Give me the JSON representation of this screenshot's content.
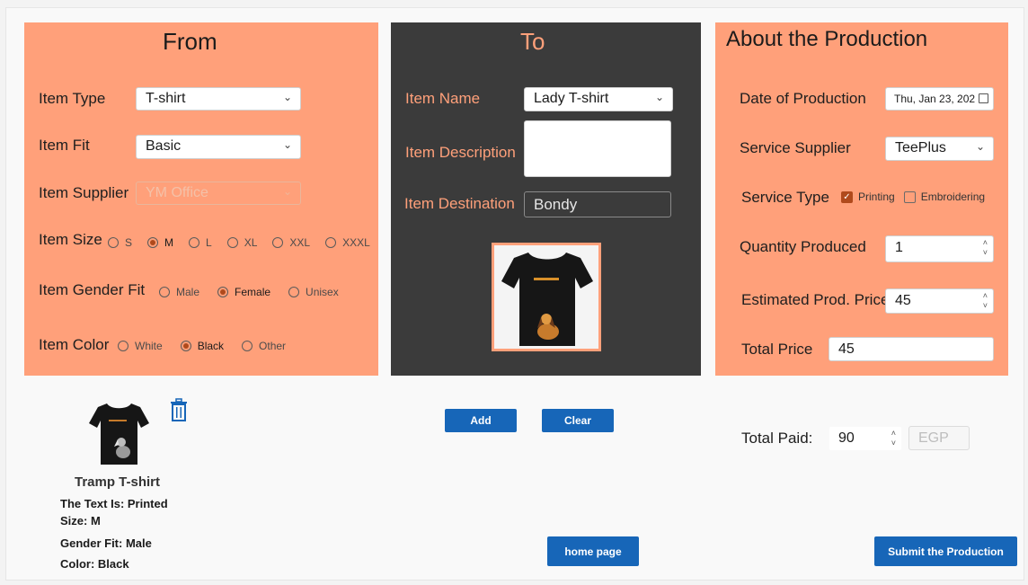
{
  "from": {
    "title": "From",
    "item_type": {
      "label": "Item Type",
      "value": "T-shirt"
    },
    "item_fit": {
      "label": "Item Fit",
      "value": "Basic"
    },
    "item_supplier": {
      "label": "Item Supplier",
      "value": "YM Office"
    },
    "item_size": {
      "label": "Item Size",
      "options": [
        "S",
        "M",
        "L",
        "XL",
        "XXL",
        "XXXL"
      ],
      "selected": "M"
    },
    "item_gender_fit": {
      "label": "Item Gender Fit",
      "options": [
        "Male",
        "Female",
        "Unisex"
      ],
      "selected": "Female"
    },
    "item_color": {
      "label": "Item Color",
      "options": [
        "White",
        "Black",
        "Other"
      ],
      "selected": "Black"
    }
  },
  "to": {
    "title": "To",
    "item_name": {
      "label": "Item Name",
      "value": "Lady T-shirt"
    },
    "item_description": {
      "label": "Item Description",
      "value": ""
    },
    "item_destination": {
      "label": "Item Destination",
      "value": "Bondy"
    }
  },
  "about": {
    "title": "About the Production",
    "date_of_production": {
      "label": "Date of Production",
      "value": "Thu, Jan 23, 202"
    },
    "service_supplier": {
      "label": "Service Supplier",
      "value": "TeePlus"
    },
    "service_type": {
      "label": "Service Type",
      "options": [
        {
          "label": "Printing",
          "checked": true
        },
        {
          "label": "Embroidering",
          "checked": false
        }
      ]
    },
    "quantity_produced": {
      "label": "Quantity Produced",
      "value": "1"
    },
    "estimated_price": {
      "label": "Estimated Prod. Price",
      "value": "45"
    },
    "total_price": {
      "label": "Total Price",
      "value": "45"
    }
  },
  "actions": {
    "add": "Add",
    "clear": "Clear",
    "home": "home page",
    "submit": "Submit the Production"
  },
  "payment": {
    "label": "Total Paid:",
    "value": "90",
    "currency": "EGP"
  },
  "cart_item": {
    "name": "Tramp T-shirt",
    "text": "The Text Is: Printed",
    "size": "Size: M",
    "gender_fit": "Gender Fit: Male",
    "color": "Color: Black"
  },
  "colors": {
    "accent": "#ffa07a",
    "dark_panel": "#3b3b3b",
    "button": "#1766b8"
  }
}
